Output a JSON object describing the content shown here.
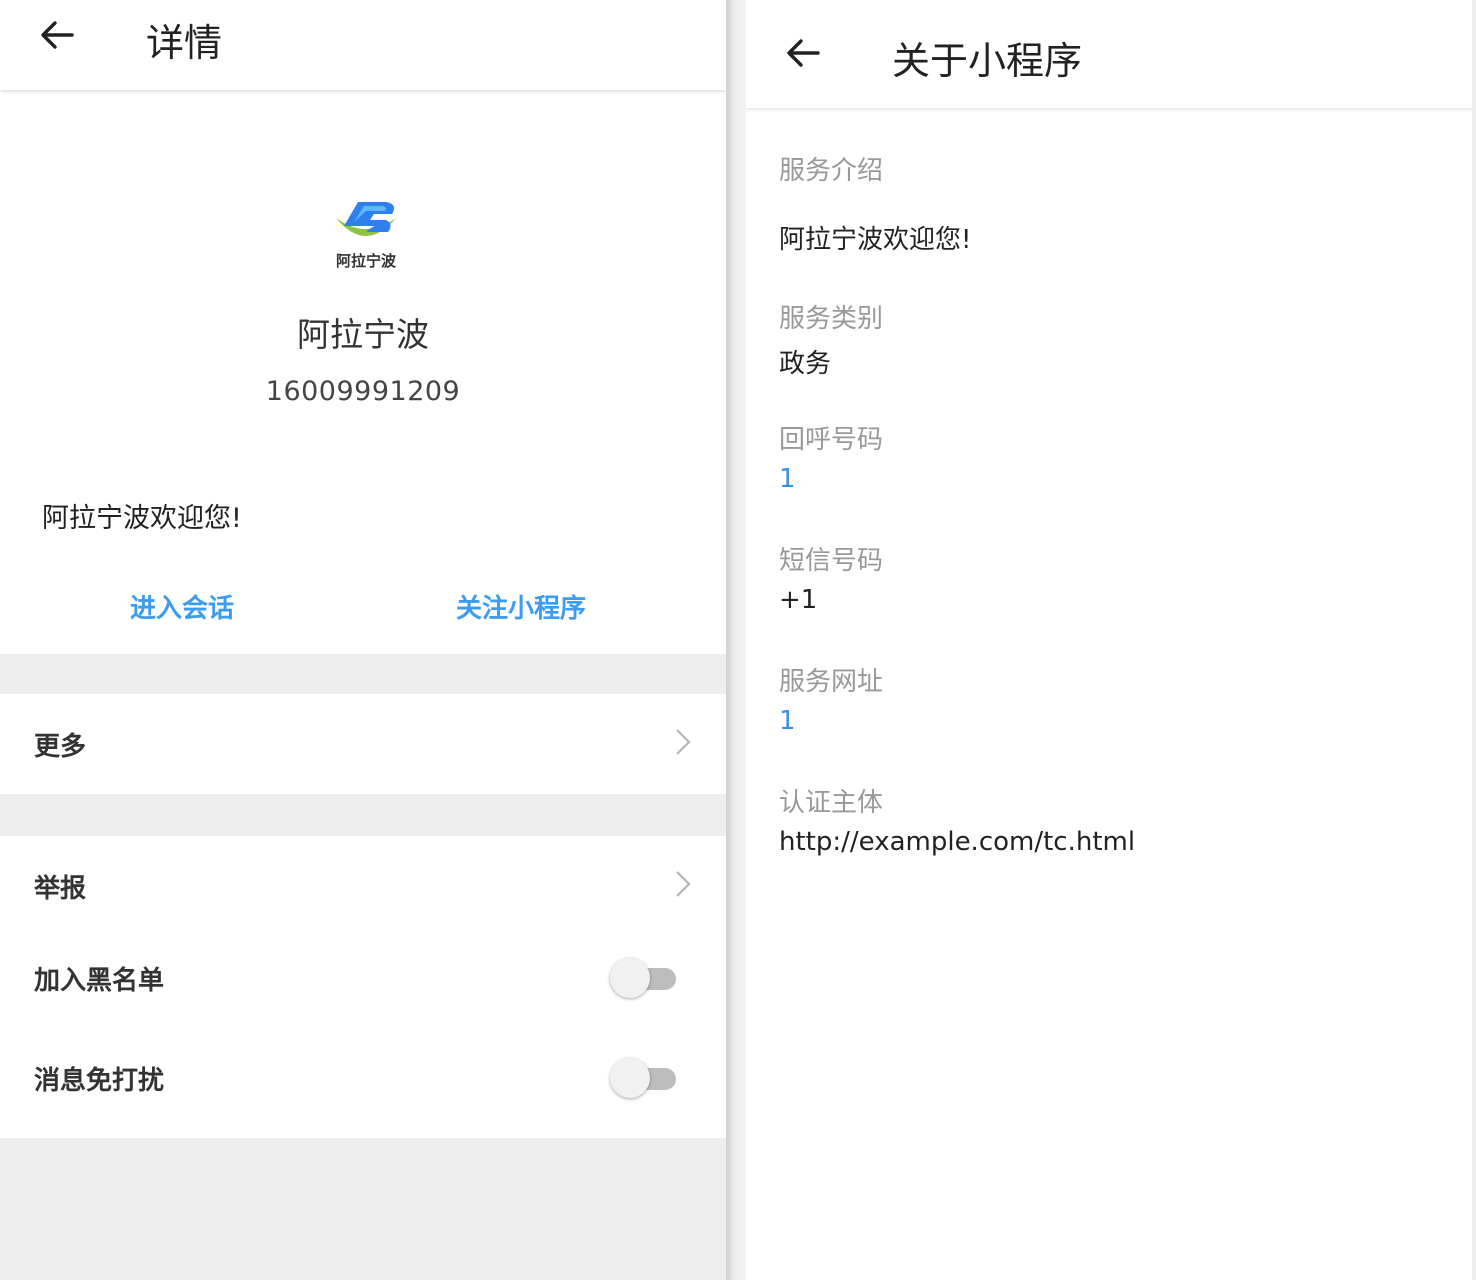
{
  "left": {
    "header": {
      "title": "详情"
    },
    "profile": {
      "logo_text": "阿拉宁波",
      "name": "阿拉宁波",
      "phone": "16009991209",
      "description": "阿拉宁波欢迎您!"
    },
    "actions": {
      "enter_chat": "进入会话",
      "follow": "关注小程序"
    },
    "more": {
      "label": "更多"
    },
    "settings": {
      "report": "举报",
      "blacklist": "加入黑名单",
      "blacklist_on": false,
      "mute": "消息免打扰",
      "mute_on": false
    }
  },
  "right": {
    "header": {
      "title": "关于小程序"
    },
    "fields": [
      {
        "label": "服务介绍",
        "value": "阿拉宁波欢迎您!"
      },
      {
        "label": "服务类别",
        "value": "政务"
      },
      {
        "label": "回呼号码",
        "value": "1"
      },
      {
        "label": "短信号码",
        "value": "+1"
      },
      {
        "label": "服务网址",
        "value": "1"
      },
      {
        "label": "认证主体",
        "value": "http://example.com/tc.html"
      }
    ]
  },
  "colors": {
    "link_blue": "#3b9cf0",
    "label_gray": "#999999",
    "logo_blue": "#2f80ed",
    "logo_green": "#8cc63f"
  }
}
